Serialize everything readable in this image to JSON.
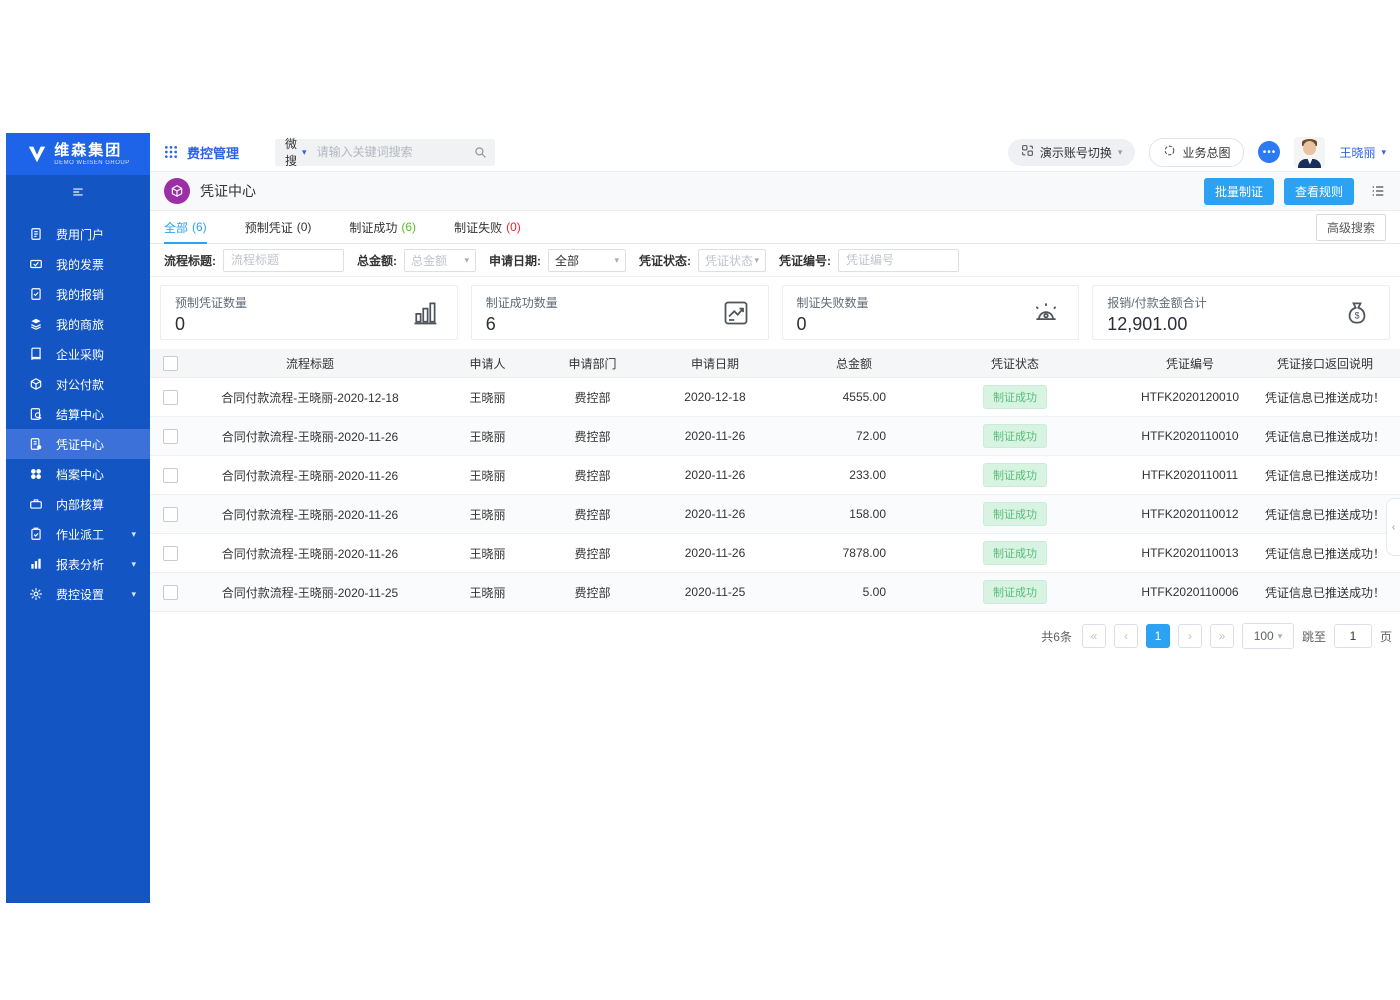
{
  "brand": {
    "name": "维森集团",
    "subtitle": "DEMO WEISEN GROUP"
  },
  "colors": {
    "sidebar_blue": "#1355c3",
    "sidebar_logo_blue": "#1e64e8",
    "sidebar_active_blue": "#3b71d8",
    "accent_blue": "#2ba2f2",
    "link_blue": "#2d63e2",
    "success_green": "#52c41a",
    "danger_red": "#f5222d",
    "badge_green_bg": "#d8f3e1",
    "badge_green_text": "#57bd79",
    "title_purple": "#9b2fa5"
  },
  "topbar": {
    "app_title": "费控管理",
    "search_scope": "微搜",
    "search_placeholder": "请输入关键词搜索",
    "account_switch_label": "演示账号切换",
    "business_map_label": "业务总图",
    "more_glyph": "•••",
    "user_name": "王晓丽"
  },
  "sidebar": {
    "collapse_icon": "collapse-icon",
    "items": [
      {
        "key": "expense-portal",
        "icon": "portal-icon",
        "label": "费用门户"
      },
      {
        "key": "my-invoice",
        "icon": "invoice-icon",
        "label": "我的发票"
      },
      {
        "key": "my-reimburse",
        "icon": "reimburse-icon",
        "label": "我的报销"
      },
      {
        "key": "my-travel",
        "icon": "travel-icon",
        "label": "我的商旅"
      },
      {
        "key": "enterprise-purchase",
        "icon": "purchase-icon",
        "label": "企业采购"
      },
      {
        "key": "corporate-payment",
        "icon": "payment-icon",
        "label": "对公付款"
      },
      {
        "key": "settlement-center",
        "icon": "settlement-icon",
        "label": "结算中心"
      },
      {
        "key": "voucher-center",
        "icon": "voucher-icon",
        "label": "凭证中心",
        "active": true
      },
      {
        "key": "archive-center",
        "icon": "archive-icon",
        "label": "档案中心"
      },
      {
        "key": "internal-accounting",
        "icon": "accounting-icon",
        "label": "内部核算"
      },
      {
        "key": "job-dispatch",
        "icon": "dispatch-icon",
        "label": "作业派工",
        "expandable": true
      },
      {
        "key": "report-analysis",
        "icon": "report-icon",
        "label": "报表分析",
        "expandable": true
      },
      {
        "key": "expense-settings",
        "icon": "settings-icon",
        "label": "费控设置",
        "expandable": true
      }
    ]
  },
  "page": {
    "title": "凭证中心",
    "actions": {
      "batch_voucher": "批量制证",
      "view_rules": "查看规则"
    },
    "tabs": [
      {
        "key": "all",
        "label": "全部",
        "count": "(6)",
        "active": true
      },
      {
        "key": "preset",
        "label": "预制凭证",
        "count": "(0)"
      },
      {
        "key": "success",
        "label": "制证成功",
        "count": "(6)",
        "count_color": "#52c41a"
      },
      {
        "key": "failed",
        "label": "制证失败",
        "count": "(0)",
        "count_color": "#f5222d"
      }
    ],
    "advanced_search": "高级搜索"
  },
  "filters": [
    {
      "key": "flow-title",
      "type": "input",
      "label": "流程标题:",
      "placeholder": "流程标题"
    },
    {
      "key": "total-amount",
      "type": "select",
      "label": "总金额:",
      "value": "总金额",
      "placeholder": true
    },
    {
      "key": "apply-date",
      "type": "select",
      "label": "申请日期:",
      "value": "全部"
    },
    {
      "key": "voucher-status",
      "type": "select",
      "label": "凭证状态:",
      "value": "凭证状态",
      "placeholder": true
    },
    {
      "key": "voucher-no",
      "type": "input",
      "label": "凭证编号:",
      "placeholder": "凭证编号"
    }
  ],
  "stats": [
    {
      "key": "preset-count",
      "icon": "bar-chart-icon",
      "label": "预制凭证数量",
      "value": "0"
    },
    {
      "key": "success-count",
      "icon": "line-chart-icon",
      "label": "制证成功数量",
      "value": "6"
    },
    {
      "key": "failed-count",
      "icon": "alarm-icon",
      "label": "制证失败数量",
      "value": "0"
    },
    {
      "key": "amount-total",
      "icon": "money-bag-icon",
      "label": "报销/付款金额合计",
      "value": "12,901.00"
    }
  ],
  "table": {
    "columns": [
      "流程标题",
      "申请人",
      "申请部门",
      "申请日期",
      "总金额",
      "凭证状态",
      "凭证编号",
      "凭证接口返回说明"
    ],
    "rows": [
      {
        "title": "合同付款流程-王晓丽-2020-12-18",
        "applicant": "王晓丽",
        "department": "费控部",
        "date": "2020-12-18",
        "amount": "4555.00",
        "status": "制证成功",
        "voucher_no": "HTFK2020120010",
        "message": "凭证信息已推送成功！"
      },
      {
        "title": "合同付款流程-王晓丽-2020-11-26",
        "applicant": "王晓丽",
        "department": "费控部",
        "date": "2020-11-26",
        "amount": "72.00",
        "status": "制证成功",
        "voucher_no": "HTFK2020110010",
        "message": "凭证信息已推送成功！"
      },
      {
        "title": "合同付款流程-王晓丽-2020-11-26",
        "applicant": "王晓丽",
        "department": "费控部",
        "date": "2020-11-26",
        "amount": "233.00",
        "status": "制证成功",
        "voucher_no": "HTFK2020110011",
        "message": "凭证信息已推送成功！"
      },
      {
        "title": "合同付款流程-王晓丽-2020-11-26",
        "applicant": "王晓丽",
        "department": "费控部",
        "date": "2020-11-26",
        "amount": "158.00",
        "status": "制证成功",
        "voucher_no": "HTFK2020110012",
        "message": "凭证信息已推送成功！"
      },
      {
        "title": "合同付款流程-王晓丽-2020-11-26",
        "applicant": "王晓丽",
        "department": "费控部",
        "date": "2020-11-26",
        "amount": "7878.00",
        "status": "制证成功",
        "voucher_no": "HTFK2020110013",
        "message": "凭证信息已推送成功！"
      },
      {
        "title": "合同付款流程-王晓丽-2020-11-25",
        "applicant": "王晓丽",
        "department": "费控部",
        "date": "2020-11-25",
        "amount": "5.00",
        "status": "制证成功",
        "voucher_no": "HTFK2020110006",
        "message": "凭证信息已推送成功！"
      }
    ]
  },
  "pagination": {
    "total_label": "共6条",
    "current_page": "1",
    "page_size": "100",
    "jump_label": "跳至",
    "jump_value": "1",
    "unit_label": "页"
  }
}
